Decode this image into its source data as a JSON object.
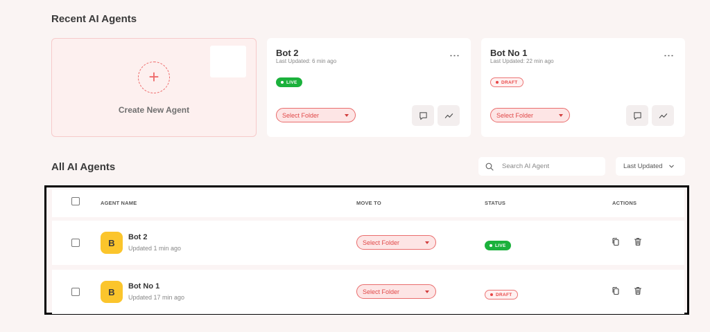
{
  "recent": {
    "title": "Recent AI Agents",
    "create_label": "Create New Agent",
    "cards": [
      {
        "name": "Bot 2",
        "updated": "Last Updated: 6 min ago",
        "status": "LIVE",
        "folder": "Select Folder"
      },
      {
        "name": "Bot No 1",
        "updated": "Last Updated: 22 min ago",
        "status": "DRAFT",
        "folder": "Select Folder"
      }
    ]
  },
  "all": {
    "title": "All AI Agents",
    "search_placeholder": "Search AI Agent",
    "sort_label": "Last Updated",
    "headers": {
      "name": "AGENT NAME",
      "move": "MOVE TO",
      "status": "STATUS",
      "actions": "ACTIONS"
    },
    "rows": [
      {
        "initial": "B",
        "name": "Bot 2",
        "updated": "Updated 1 min ago",
        "folder": "Select Folder",
        "status": "LIVE"
      },
      {
        "initial": "B",
        "name": "Bot No 1",
        "updated": "Updated 17 min ago",
        "folder": "Select Folder",
        "status": "DRAFT"
      }
    ]
  },
  "icons": [
    "plus-icon",
    "kebab-menu-icon",
    "chat-icon",
    "analytics-icon",
    "search-icon",
    "chevron-down-icon",
    "copy-icon",
    "trash-icon",
    "caret-down-icon"
  ],
  "colors": {
    "accent": "#ee6b6b",
    "live": "#1bb13c",
    "draft": "#e84848",
    "avatar": "#fbc52c",
    "background": "#faf4f3"
  }
}
